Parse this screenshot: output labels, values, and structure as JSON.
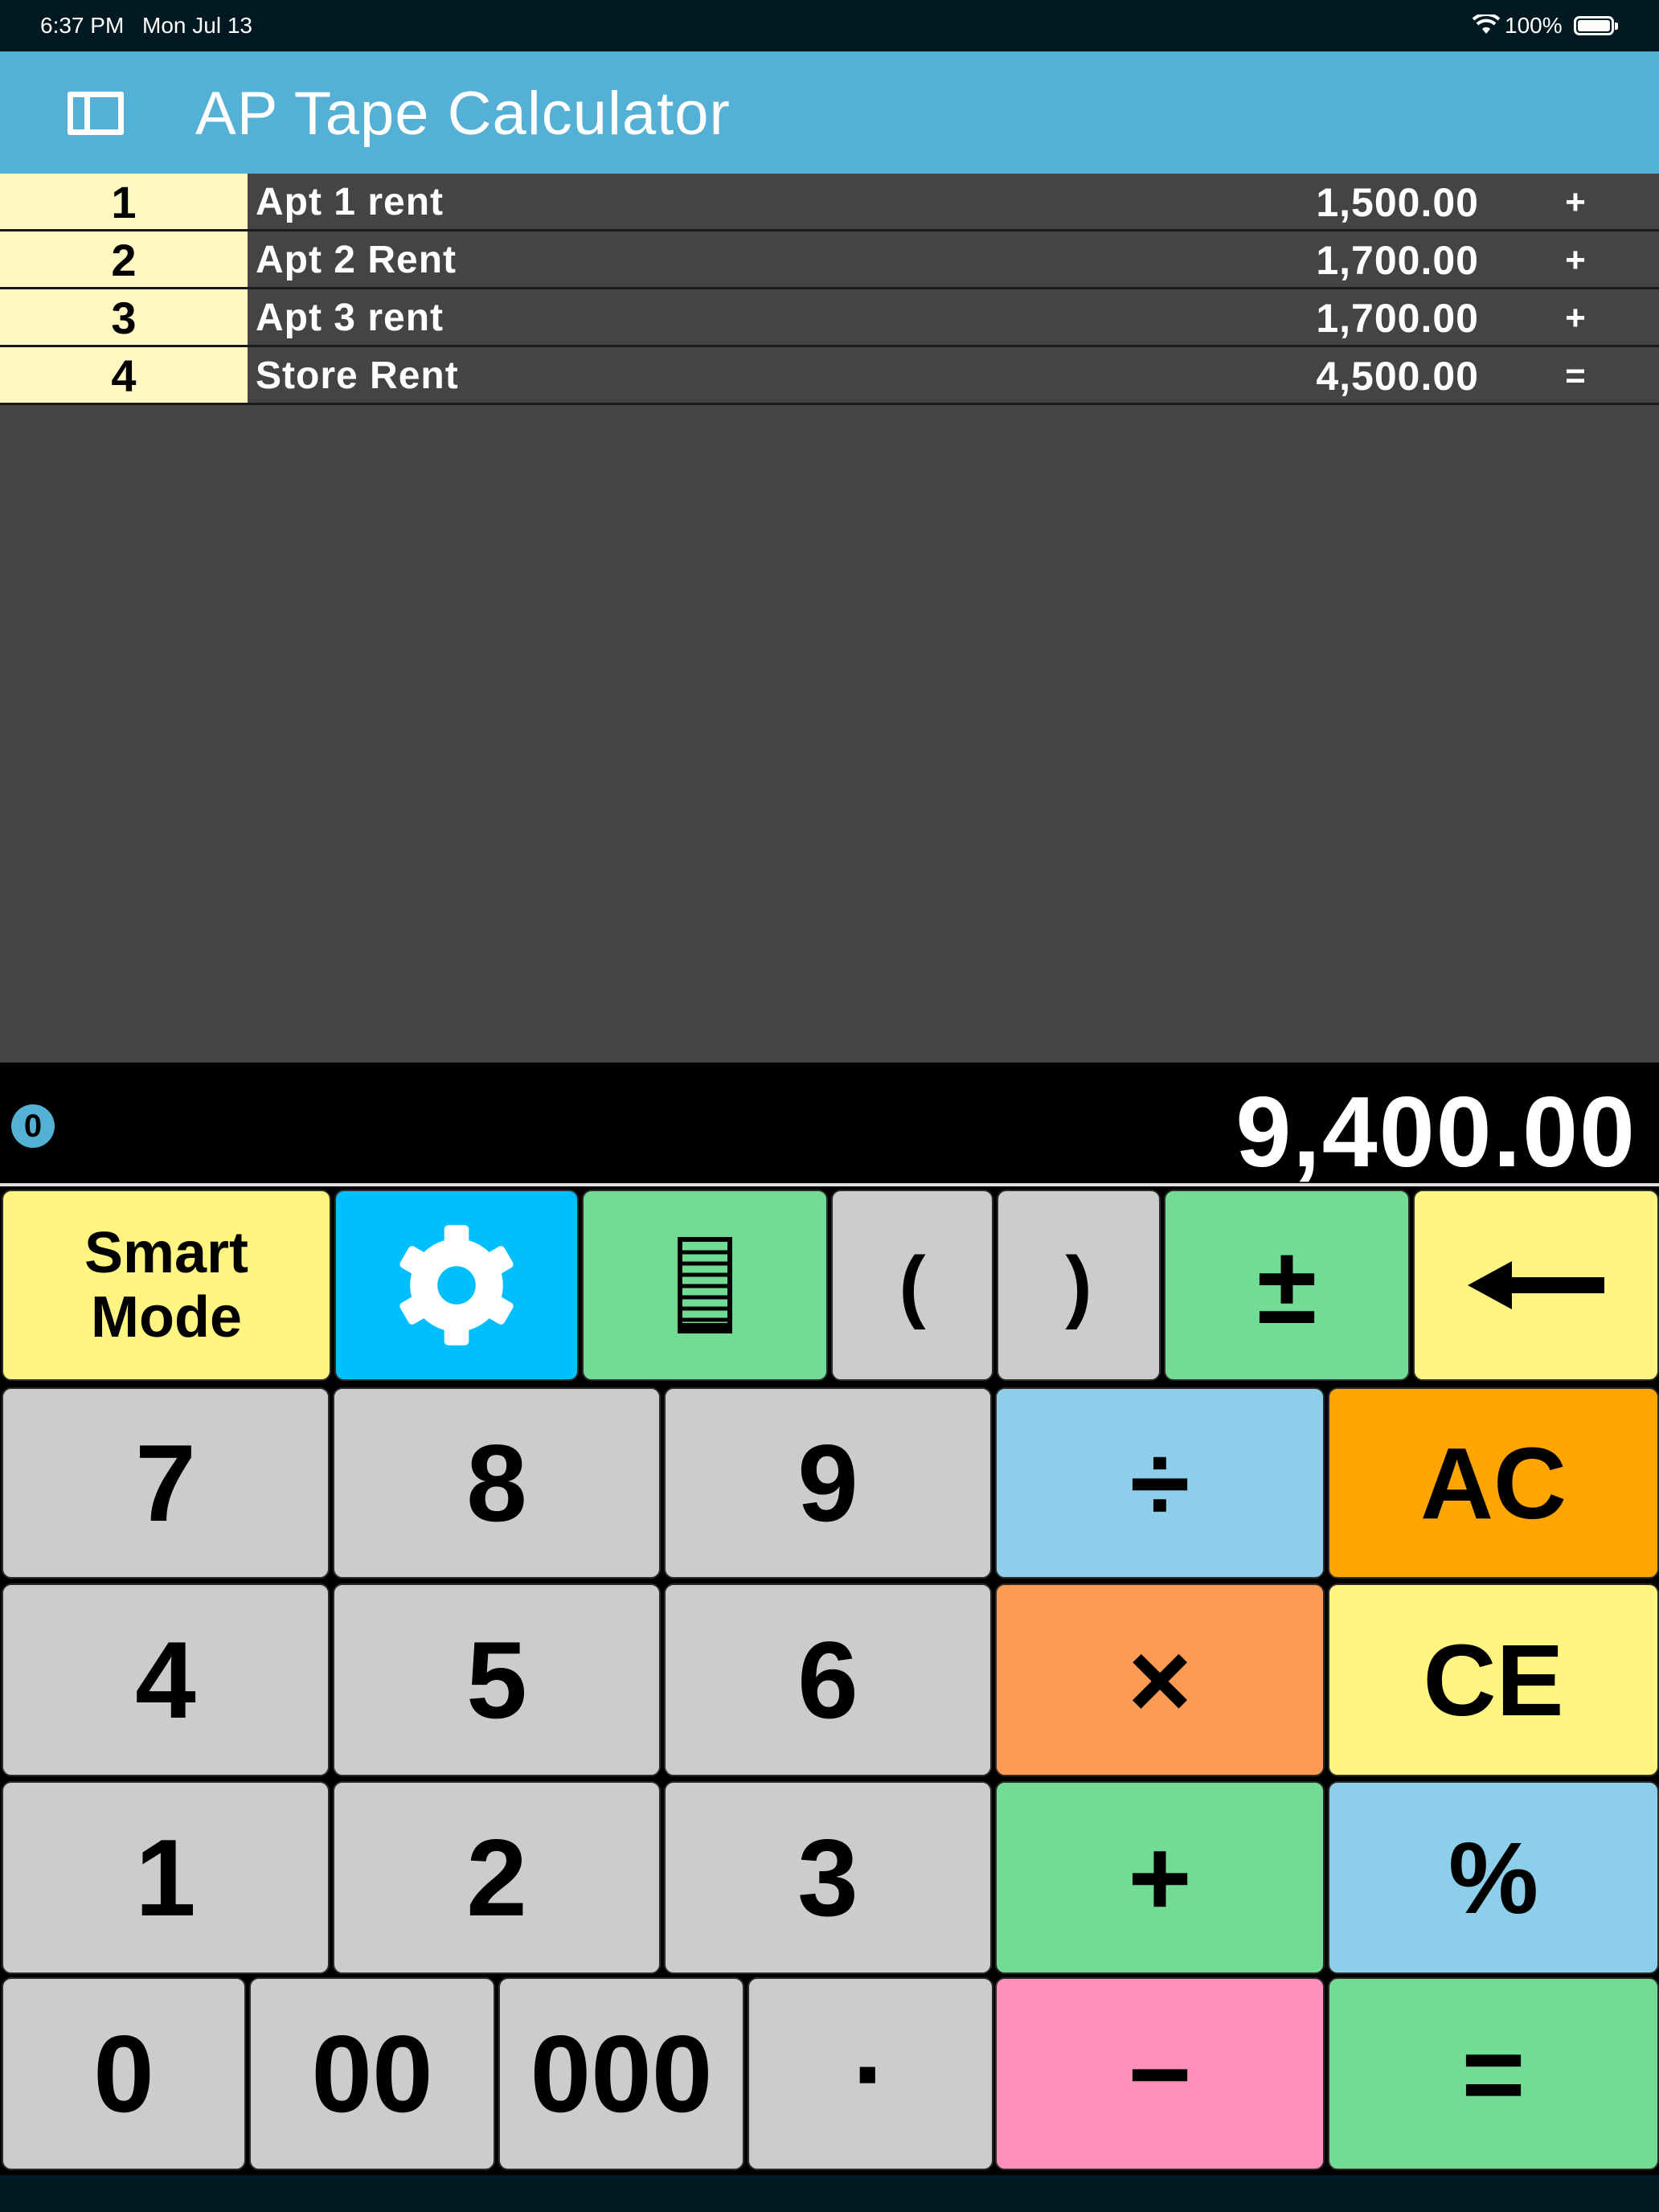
{
  "status_bar": {
    "time": "6:37 PM",
    "date": "Mon Jul 13",
    "battery_percent": "100%"
  },
  "nav": {
    "title": "AP Tape Calculator",
    "sidebar_icon": "sidebar-toggle-icon"
  },
  "tape": {
    "rows": [
      {
        "num": "1",
        "desc": "Apt 1 rent",
        "amount": "1,500.00",
        "op": "+"
      },
      {
        "num": "2",
        "desc": "Apt 2 Rent",
        "amount": "1,700.00",
        "op": "+"
      },
      {
        "num": "3",
        "desc": "Apt 3 rent",
        "amount": "1,700.00",
        "op": "+"
      },
      {
        "num": "4",
        "desc": "Store Rent",
        "amount": "4,500.00",
        "op": "="
      }
    ]
  },
  "display": {
    "counter": "0",
    "value": "9,400.00"
  },
  "keypad": {
    "smart_mode_line1": "Smart",
    "smart_mode_line2": "Mode",
    "settings_icon": "gear-icon",
    "tape_icon": "tape-list-icon",
    "open_paren": "(",
    "close_paren": ")",
    "plus_minus": "±",
    "backspace_icon": "backspace-arrow-icon",
    "d7": "7",
    "d8": "8",
    "d9": "9",
    "divide": "÷",
    "ac": "AC",
    "d4": "4",
    "d5": "5",
    "d6": "6",
    "multiply": "×",
    "ce": "CE",
    "d1": "1",
    "d2": "2",
    "d3": "3",
    "plus": "+",
    "percent": "%",
    "d0": "0",
    "d00": "00",
    "d000": "000",
    "decimal": "·",
    "minus": "−",
    "equals": "="
  },
  "colors": {
    "nav_bg": "#55b0d5",
    "tape_bg": "#444444",
    "row_number_bg": "#fff8c0",
    "key_gray": "#cccccc",
    "key_yellow": "#fff580",
    "key_blue": "#00bfff",
    "key_green": "#72db94",
    "key_lightblue": "#8dcfea",
    "key_orange": "#ffa500",
    "key_salmon": "#ff9a55",
    "key_pink": "#ff8fbb"
  }
}
